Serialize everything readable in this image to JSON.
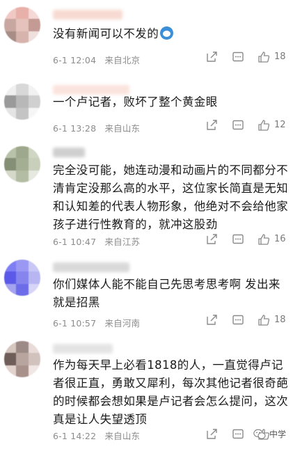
{
  "comments": [
    {
      "text": "没有新闻可以不发的",
      "date": "6-1",
      "time": "12:04",
      "location": "来自北京",
      "likes": "18",
      "emoji": "doraemon-emoji"
    },
    {
      "text": "一个卢记者，败坏了整个黄金眼",
      "date": "6-1",
      "time": "13:28",
      "location": "来自山东",
      "likes": "12"
    },
    {
      "text": "完全没可能，她连动漫和动画片的不同都分不清肯定没那么高的水平，这位家长简直是无知和认知差的代表人物形象，他绝对不会给他家孩子进行性教育的，就冲这股劲",
      "date": "6-1",
      "time": "10:47",
      "location": "来自江苏",
      "likes": "16"
    },
    {
      "text": "你们媒体人能不能自己先思考思考啊 发出来就是招黑",
      "date": "6-1",
      "time": "10:57",
      "location": "来自河南",
      "likes": "18"
    },
    {
      "text": "作为每天早上必看1818的人，一直觉得卢记者很正直，勇敢又犀利，每次其他记者很奇葩的时候都会想如果是卢记者会怎么提问，这次真是让人失望透顶",
      "date": "6-1",
      "time": "14:22",
      "location": "来自山东",
      "likes": ""
    }
  ],
  "watermark": {
    "text": "中学",
    "icon": "wechat-icon"
  },
  "colors": {
    "text": "#1a1a1a",
    "meta": "#8c8c8c",
    "icon": "#8a8a8a"
  }
}
